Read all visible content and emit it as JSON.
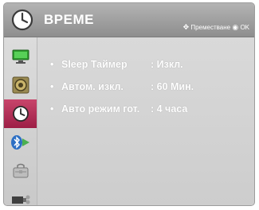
{
  "header": {
    "title": "ВРЕМЕ",
    "nav_hint": "Преместване",
    "ok_label": "OK"
  },
  "sidebar": {
    "items": [
      {
        "icon": "picture-icon",
        "active": false
      },
      {
        "icon": "audio-icon",
        "active": false
      },
      {
        "icon": "time-icon",
        "active": true
      },
      {
        "icon": "bluetooth-icon",
        "active": false
      },
      {
        "icon": "lock-icon",
        "active": false
      },
      {
        "icon": "input-icon",
        "active": false
      }
    ]
  },
  "settings": [
    {
      "bullet": "•",
      "label": "Sleep Таймер",
      "value": ": Изкл."
    },
    {
      "bullet": "•",
      "label": "Автом. изкл.",
      "value": ": 60 Мин."
    },
    {
      "bullet": "•",
      "label": "Авто режим гот.",
      "value": ": 4 часа"
    }
  ],
  "colors": {
    "active_item": "#b0305a",
    "header": "#a0a0a0"
  }
}
